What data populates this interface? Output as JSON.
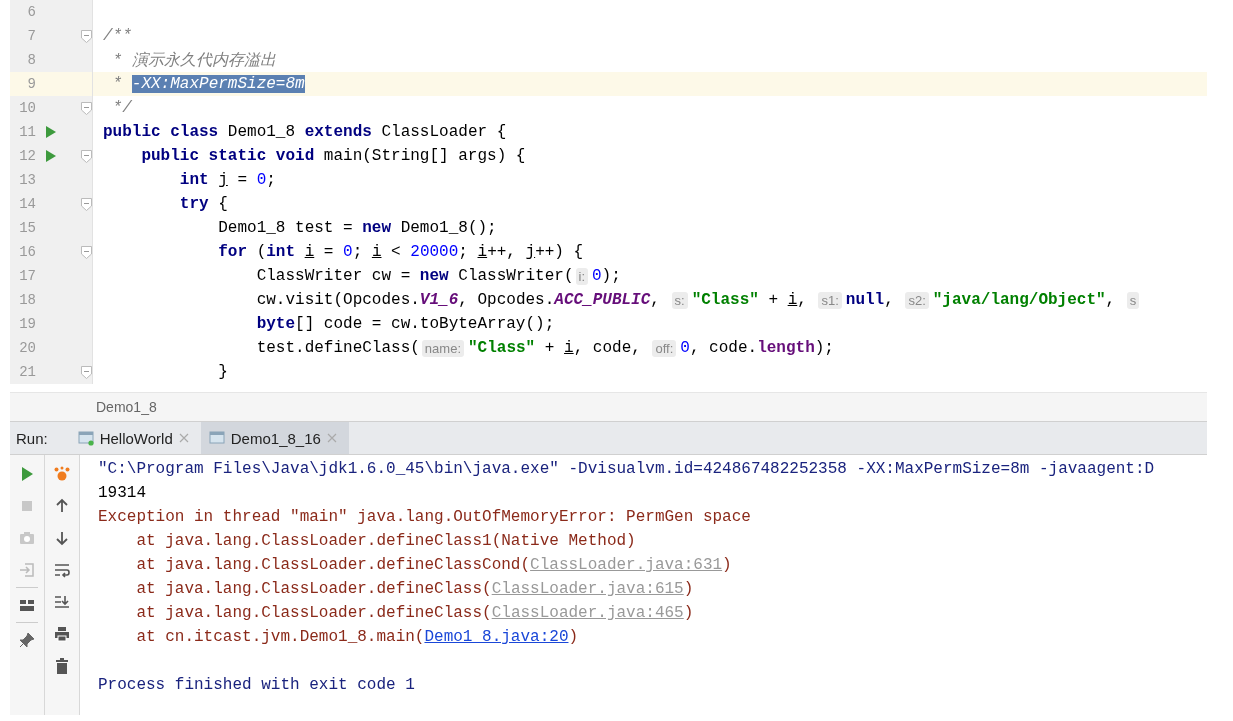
{
  "editor": {
    "lines": [
      {
        "number": "6",
        "run_marker": false,
        "fold_marker": false,
        "current": false
      },
      {
        "number": "7",
        "run_marker": false,
        "fold_marker": true,
        "current": false,
        "tokens": [
          {
            "kind": "cmt",
            "t": "/**"
          }
        ]
      },
      {
        "number": "8",
        "run_marker": false,
        "fold_marker": false,
        "current": false,
        "tokens": [
          {
            "kind": "cmt",
            "t": " * 演示永久代内存溢出"
          }
        ]
      },
      {
        "number": "9",
        "run_marker": false,
        "fold_marker": false,
        "current": true,
        "tokens": [
          {
            "kind": "cmt",
            "t": " * "
          },
          {
            "kind": "sel",
            "t": "-XX:MaxPermSize=8m"
          }
        ]
      },
      {
        "number": "10",
        "run_marker": false,
        "fold_marker": true,
        "current": false,
        "tokens": [
          {
            "kind": "cmt",
            "t": " */"
          }
        ]
      },
      {
        "number": "11",
        "run_marker": true,
        "fold_marker": false,
        "current": false,
        "tokens": [
          {
            "kind": "kw",
            "t": "public class"
          },
          {
            "kind": "plain",
            "t": " Demo1_8 "
          },
          {
            "kind": "kw",
            "t": "extends"
          },
          {
            "kind": "plain",
            "t": " ClassLoader {"
          }
        ]
      },
      {
        "number": "12",
        "run_marker": true,
        "fold_marker": true,
        "current": false,
        "tokens": [
          {
            "kind": "kw",
            "t": "    public static void"
          },
          {
            "kind": "plain",
            "t": " main(String[] args) {"
          }
        ]
      },
      {
        "number": "13",
        "run_marker": false,
        "fold_marker": false,
        "current": false,
        "tokens": [
          {
            "kind": "kw",
            "t": "        int "
          },
          {
            "kind": "var",
            "t": "j"
          },
          {
            "kind": "plain",
            "t": " = "
          },
          {
            "kind": "num",
            "t": "0"
          },
          {
            "kind": "plain",
            "t": ";"
          }
        ]
      },
      {
        "number": "14",
        "run_marker": false,
        "fold_marker": true,
        "current": false,
        "tokens": [
          {
            "kind": "kw",
            "t": "        try"
          },
          {
            "kind": "plain",
            "t": " {"
          }
        ]
      },
      {
        "number": "15",
        "run_marker": false,
        "fold_marker": false,
        "current": false,
        "tokens": [
          {
            "kind": "plain",
            "t": "            Demo1_8 test = "
          },
          {
            "kind": "kw",
            "t": "new"
          },
          {
            "kind": "plain",
            "t": " Demo1_8();"
          }
        ]
      },
      {
        "number": "16",
        "run_marker": false,
        "fold_marker": true,
        "current": false,
        "tokens": [
          {
            "kind": "kw",
            "t": "            for"
          },
          {
            "kind": "plain",
            "t": " ("
          },
          {
            "kind": "kw",
            "t": "int "
          },
          {
            "kind": "var",
            "t": "i"
          },
          {
            "kind": "plain",
            "t": " = "
          },
          {
            "kind": "num",
            "t": "0"
          },
          {
            "kind": "plain",
            "t": "; "
          },
          {
            "kind": "var",
            "t": "i"
          },
          {
            "kind": "plain",
            "t": " < "
          },
          {
            "kind": "num",
            "t": "20000"
          },
          {
            "kind": "plain",
            "t": "; "
          },
          {
            "kind": "var",
            "t": "i"
          },
          {
            "kind": "plain",
            "t": "++, "
          },
          {
            "kind": "var",
            "t": "j"
          },
          {
            "kind": "plain",
            "t": "++) {"
          }
        ]
      },
      {
        "number": "17",
        "run_marker": false,
        "fold_marker": false,
        "current": false,
        "tokens": [
          {
            "kind": "plain",
            "t": "                ClassWriter cw = "
          },
          {
            "kind": "kw",
            "t": "new"
          },
          {
            "kind": "plain",
            "t": " ClassWriter("
          },
          {
            "kind": "hint",
            "t": "i:"
          },
          {
            "kind": "num",
            "t": "0"
          },
          {
            "kind": "plain",
            "t": ");"
          }
        ]
      },
      {
        "number": "18",
        "run_marker": false,
        "fold_marker": false,
        "current": false,
        "tokens": [
          {
            "kind": "plain",
            "t": "                cw.visit(Opcodes."
          },
          {
            "kind": "fld",
            "t": "V1_6"
          },
          {
            "kind": "plain",
            "t": ", Opcodes."
          },
          {
            "kind": "fld",
            "t": "ACC_PUBLIC"
          },
          {
            "kind": "plain",
            "t": ", "
          },
          {
            "kind": "hint",
            "t": "s:"
          },
          {
            "kind": "str",
            "t": "\"Class\""
          },
          {
            "kind": "plain",
            "t": " + "
          },
          {
            "kind": "var",
            "t": "i"
          },
          {
            "kind": "plain",
            "t": ", "
          },
          {
            "kind": "hint",
            "t": "s1:"
          },
          {
            "kind": "kw",
            "t": "null"
          },
          {
            "kind": "plain",
            "t": ", "
          },
          {
            "kind": "hint",
            "t": "s2:"
          },
          {
            "kind": "str",
            "t": "\"java/lang/Object\""
          },
          {
            "kind": "plain",
            "t": ", "
          },
          {
            "kind": "hint",
            "t": "s"
          }
        ]
      },
      {
        "number": "19",
        "run_marker": false,
        "fold_marker": false,
        "current": false,
        "tokens": [
          {
            "kind": "kw",
            "t": "                byte"
          },
          {
            "kind": "plain",
            "t": "[] code = cw.toByteArray();"
          }
        ]
      },
      {
        "number": "20",
        "run_marker": false,
        "fold_marker": false,
        "current": false,
        "tokens": [
          {
            "kind": "plain",
            "t": "                test.defineClass("
          },
          {
            "kind": "hint",
            "t": "name:"
          },
          {
            "kind": "str",
            "t": "\"Class\""
          },
          {
            "kind": "plain",
            "t": " + "
          },
          {
            "kind": "var",
            "t": "i"
          },
          {
            "kind": "plain",
            "t": ", code, "
          },
          {
            "kind": "hint",
            "t": "off:"
          },
          {
            "kind": "num",
            "t": "0"
          },
          {
            "kind": "plain",
            "t": ", code."
          },
          {
            "kind": "mem",
            "t": "length"
          },
          {
            "kind": "plain",
            "t": ");"
          }
        ]
      },
      {
        "number": "21",
        "run_marker": false,
        "fold_marker": true,
        "current": false,
        "tokens": [
          {
            "kind": "plain",
            "t": "            }"
          }
        ]
      }
    ]
  },
  "breadcrumb": "Demo1_8",
  "run_panel": {
    "label": "Run:",
    "tabs": [
      {
        "label": "HelloWorld",
        "selected": false,
        "running": true
      },
      {
        "label": "Demo1_8_16",
        "selected": true,
        "running": false
      }
    ],
    "console": [
      [
        {
          "kind": "cmd",
          "t": "\"C:\\Program Files\\Java\\jdk1.6.0_45\\bin\\java.exe\" -Dvisualvm.id=424867482252358 -XX:MaxPermSize=8m -javaagent:D"
        }
      ],
      [
        {
          "kind": "out",
          "t": "19314"
        }
      ],
      [
        {
          "kind": "err",
          "t": "Exception in thread \"main\" java.lang.OutOfMemoryError: PermGen space"
        }
      ],
      [
        {
          "kind": "err",
          "t": "    at java.lang.ClassLoader.defineClass1(Native Method)"
        }
      ],
      [
        {
          "kind": "err",
          "t": "    at java.lang.ClassLoader.defineClassCond("
        },
        {
          "kind": "lib",
          "t": "ClassLoader.java:631"
        },
        {
          "kind": "err",
          "t": ")"
        }
      ],
      [
        {
          "kind": "err",
          "t": "    at java.lang.ClassLoader.defineClass("
        },
        {
          "kind": "lib",
          "t": "ClassLoader.java:615"
        },
        {
          "kind": "err",
          "t": ")"
        }
      ],
      [
        {
          "kind": "err",
          "t": "    at java.lang.ClassLoader.defineClass("
        },
        {
          "kind": "lib",
          "t": "ClassLoader.java:465"
        },
        {
          "kind": "err",
          "t": ")"
        }
      ],
      [
        {
          "kind": "err",
          "t": "    at cn.itcast.jvm.Demo1_8.main("
        },
        {
          "kind": "src",
          "t": "Demo1_8.java:20"
        },
        {
          "kind": "err",
          "t": ")"
        }
      ],
      [
        {
          "kind": "exit",
          "t": "Process finished with exit code 1"
        }
      ]
    ]
  }
}
